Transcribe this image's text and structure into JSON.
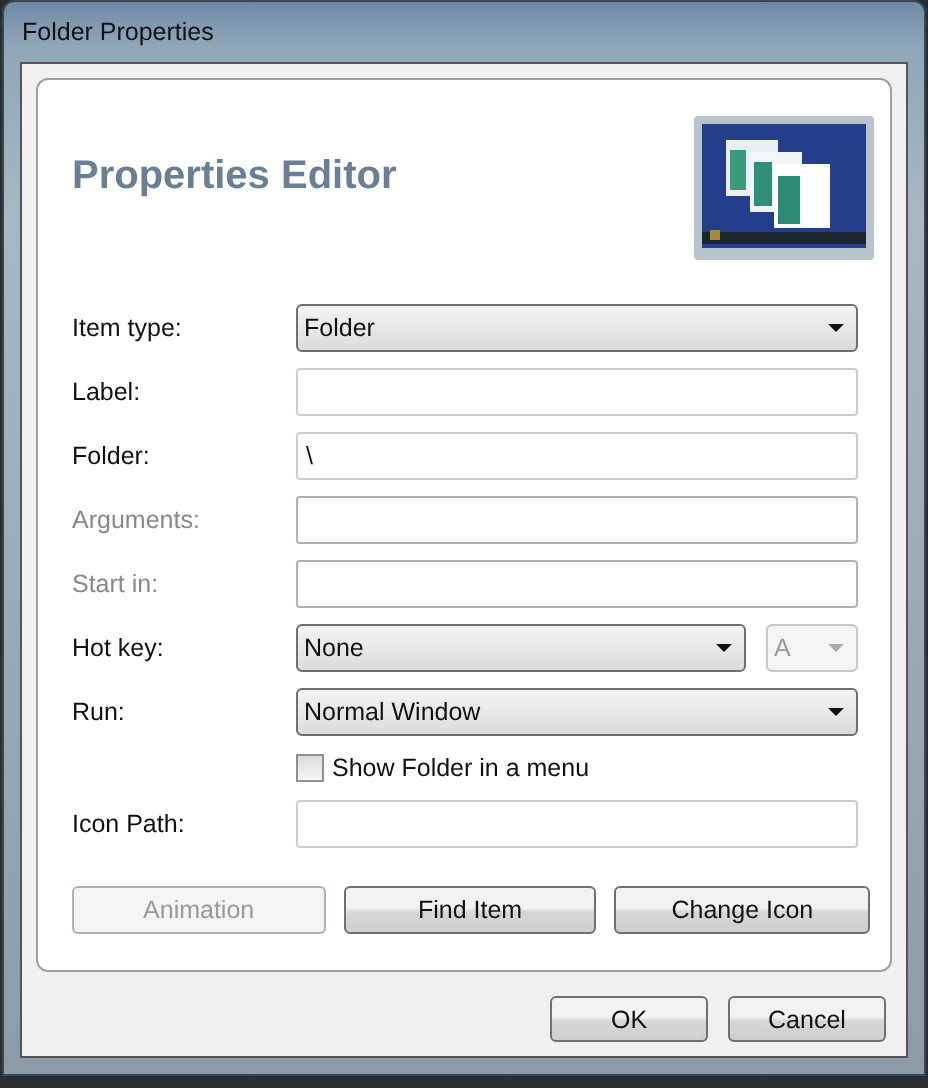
{
  "window": {
    "title": "Folder Properties"
  },
  "header": {
    "title": "Properties Editor"
  },
  "fields": [
    {
      "kind": "select",
      "label": "Item type:",
      "value": "Folder",
      "disabled": false
    },
    {
      "kind": "text",
      "label": "Label:",
      "disabled": false
    },
    {
      "kind": "text",
      "label": "Folder:",
      "value": "\\",
      "disabled": false
    },
    {
      "kind": "text",
      "label": "Arguments:",
      "disabled": true
    },
    {
      "kind": "text",
      "label": "Start in:",
      "disabled": true
    },
    {
      "kind": "hotkey",
      "label": "Hot key:",
      "value": "None",
      "disabled": false,
      "key": "A",
      "key_disabled": true
    },
    {
      "kind": "select",
      "label": "Run:",
      "value": "Normal Window",
      "disabled": false
    },
    {
      "kind": "checkbox",
      "label": "Show Folder in a menu",
      "checked": false
    },
    {
      "kind": "text",
      "label": "Icon Path:",
      "disabled": false
    }
  ],
  "actions": [
    {
      "label": "Animation",
      "disabled": true
    },
    {
      "label": "Find Item",
      "disabled": false
    },
    {
      "label": "Change Icon",
      "disabled": false
    }
  ],
  "buttons": [
    "OK",
    "Cancel"
  ]
}
